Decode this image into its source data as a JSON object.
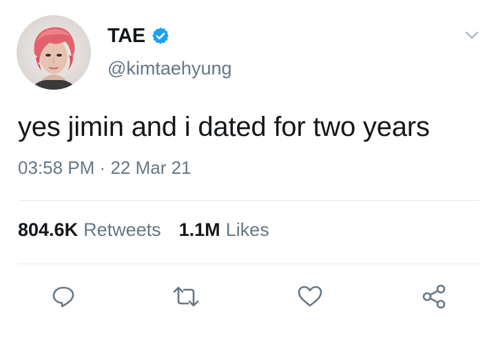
{
  "tweet": {
    "display_name": "TAE",
    "handle": "@kimtaehyung",
    "verified_icon": "verified-badge-icon",
    "text": "yes jimin and i dated for two years",
    "time": "03:58 PM",
    "separator": "·",
    "date": "22 Mar 21"
  },
  "stats": {
    "retweets_count": "804.6K",
    "retweets_label": "Retweets",
    "likes_count": "1.1M",
    "likes_label": "Likes"
  },
  "actions": [
    {
      "icon": "reply-icon"
    },
    {
      "icon": "retweet-icon"
    },
    {
      "icon": "like-icon"
    },
    {
      "icon": "share-icon"
    }
  ],
  "colors": {
    "text_primary": "#14171a",
    "text_secondary": "#657786",
    "verified_blue": "#1da1f2",
    "divider": "#e1e8ed",
    "icon_gray": "#657786"
  }
}
